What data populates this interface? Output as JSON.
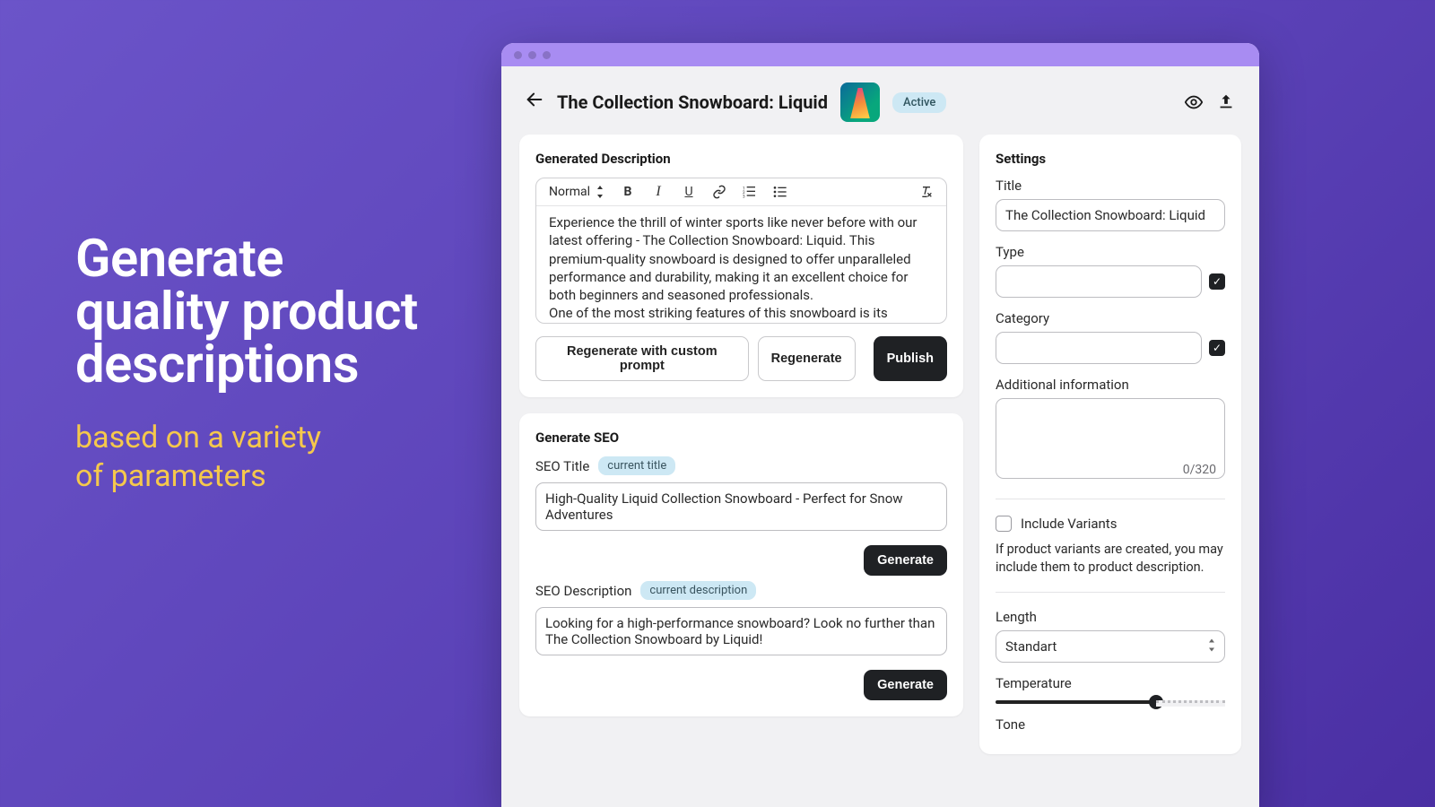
{
  "promo": {
    "headline_l1": "Generate",
    "headline_l2": "quality product",
    "headline_l3": "descriptions",
    "sub_l1": "based on a variety",
    "sub_l2": "of parameters"
  },
  "header": {
    "title": "The Collection Snowboard: Liquid",
    "status_badge": "Active"
  },
  "generated": {
    "heading": "Generated Description",
    "format_label": "Normal",
    "body_p1": "Experience the thrill of winter sports like never before with our latest offering - The Collection Snowboard: Liquid. This premium-quality snowboard is designed to offer unparalleled performance and durability, making it an excellent choice for both beginners and seasoned professionals.",
    "body_p2_truncated": "One of the most striking features of this snowboard is its elegan…",
    "btn_regenerate_custom": "Regenerate with custom prompt",
    "btn_regenerate": "Regenerate",
    "btn_publish": "Publish"
  },
  "seo": {
    "heading": "Generate SEO",
    "title_label": "SEO Title",
    "title_pill": "current title",
    "title_value": "High-Quality Liquid Collection Snowboard - Perfect for Snow Adventures",
    "btn_generate_title": "Generate",
    "desc_label": "SEO Description",
    "desc_pill": "current description",
    "desc_value": "Looking for a high-performance snowboard? Look no further than The Collection Snowboard by Liquid!",
    "btn_generate_desc": "Generate"
  },
  "settings": {
    "heading": "Settings",
    "title_label": "Title",
    "title_value": "The Collection Snowboard: Liquid",
    "type_label": "Type",
    "type_value": "",
    "category_label": "Category",
    "category_value": "",
    "additional_label": "Additional information",
    "additional_value": "",
    "additional_counter": "0/320",
    "include_variants_label": "Include Variants",
    "include_variants_help": "If product variants are created, you may include them to product description.",
    "length_label": "Length",
    "length_value": "Standart",
    "temperature_label": "Temperature",
    "tone_label": "Tone"
  }
}
